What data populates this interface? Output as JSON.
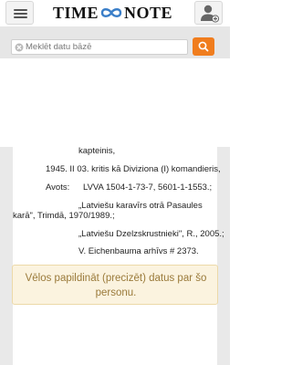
{
  "header": {
    "logo_left": "TIME",
    "logo_right": "NOTE",
    "menu_icon": "hamburger-menu-icon",
    "user_icon": "user-add-icon"
  },
  "search": {
    "placeholder": "Meklēt datu bāzē",
    "clear_icon": "clear-x-icon",
    "button_color": "#f07d1e"
  },
  "record": {
    "rank": "kapteinis,",
    "event": "1945. II 03. kritis kā Diviziona (I) komandieris,",
    "sources_label": "Avots:",
    "sources": [
      "LVVA 1504-1-73-7, 5601-1-1553.;",
      "„Latviešu karavīrs otrā Pasaules",
      "karā\", Trimdā, 1970/1989.;",
      "„Latviešu Dzelzskrustnieki\", R., 2005.;",
      "V. Eichenbauma arhīvs # 2373."
    ]
  },
  "notice": {
    "text": "Vēlos papildināt (precizēt) datus par šo personu."
  }
}
